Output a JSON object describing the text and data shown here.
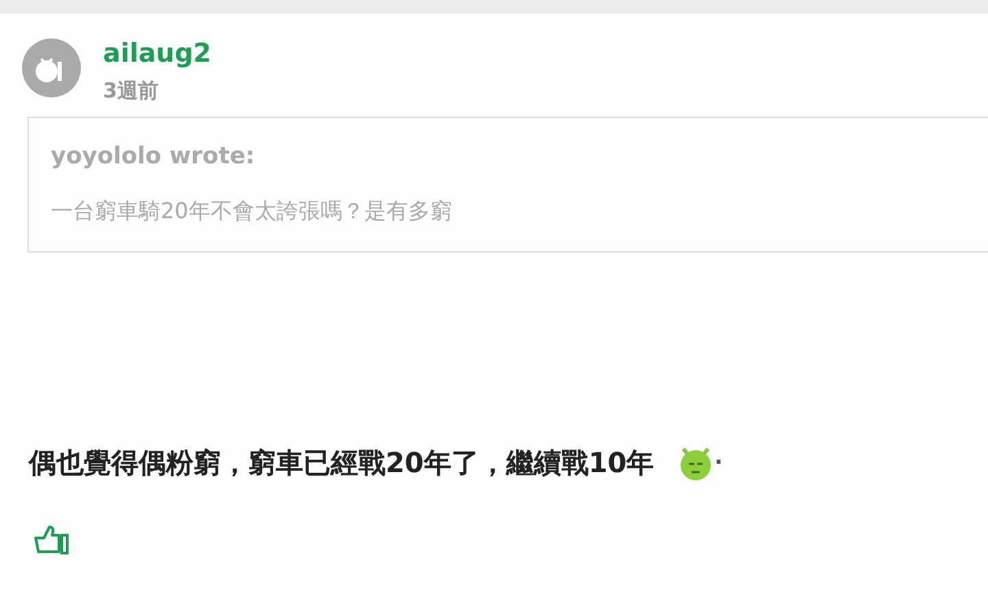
{
  "post": {
    "author": "ailaug2",
    "time": "3週前",
    "quote": {
      "author_line": "yoyololo wrote:",
      "text": "一台窮車騎20年不會太誇張嗎？是有多窮"
    },
    "body": "偶也覺得偶粉窮，窮車已經戰20年了，繼續戰10年",
    "trailing": "·"
  }
}
